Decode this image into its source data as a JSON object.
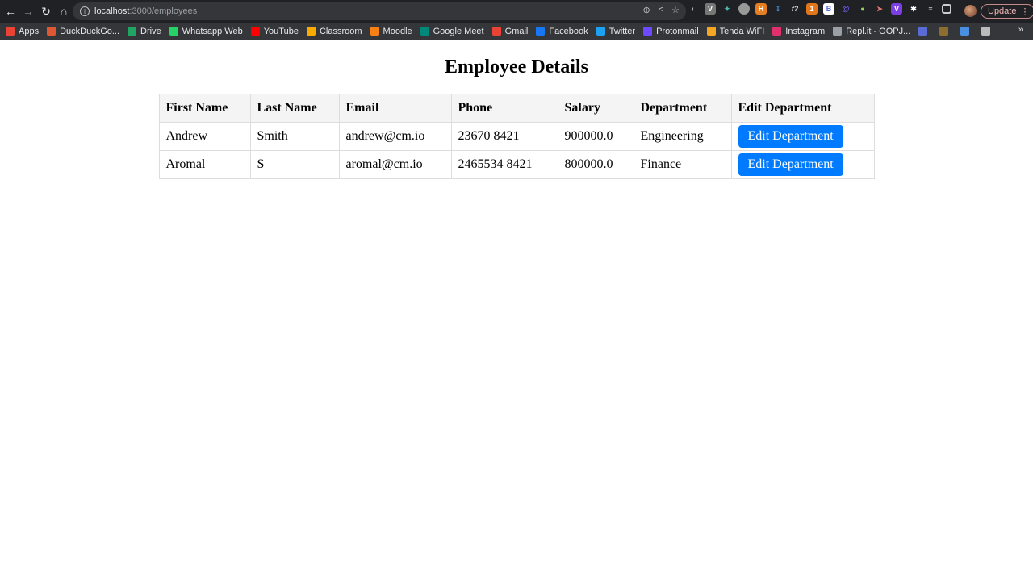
{
  "browser": {
    "url_host": "localhost",
    "url_path": ":3000/employees",
    "update_label": "Update",
    "bookmarks": [
      {
        "label": "Apps",
        "icon": "apps-grid-icon",
        "color": "#ea4335"
      },
      {
        "label": "DuckDuckGo...",
        "icon": "duckduckgo-icon",
        "color": "#de5833"
      },
      {
        "label": "Drive",
        "icon": "google-drive-icon",
        "color": "#1fa463"
      },
      {
        "label": "Whatsapp Web",
        "icon": "whatsapp-icon",
        "color": "#25d366"
      },
      {
        "label": "YouTube",
        "icon": "youtube-icon",
        "color": "#ff0000"
      },
      {
        "label": "Classroom",
        "icon": "classroom-icon",
        "color": "#f9ab00"
      },
      {
        "label": "Moodle",
        "icon": "moodle-icon",
        "color": "#f98012"
      },
      {
        "label": "Google Meet",
        "icon": "google-meet-icon",
        "color": "#00897b"
      },
      {
        "label": "Gmail",
        "icon": "gmail-icon",
        "color": "#ea4335"
      },
      {
        "label": "Facebook",
        "icon": "facebook-icon",
        "color": "#1877f2"
      },
      {
        "label": "Twitter",
        "icon": "twitter-icon",
        "color": "#1da1f2"
      },
      {
        "label": "Protonmail",
        "icon": "protonmail-icon",
        "color": "#6d4aff"
      },
      {
        "label": "Tenda WiFI",
        "icon": "tenda-icon",
        "color": "#f5a623"
      },
      {
        "label": "Instagram",
        "icon": "instagram-icon",
        "color": "#e1306c"
      },
      {
        "label": "Repl.it - OOPJ...",
        "icon": "replit-icon",
        "color": "#9aa0a6"
      }
    ],
    "more_label": "»"
  },
  "page": {
    "title": "Employee Details",
    "table": {
      "headers": [
        "First Name",
        "Last Name",
        "Email",
        "Phone",
        "Salary",
        "Department",
        "Edit Department"
      ],
      "rows": [
        {
          "first_name": "Andrew",
          "last_name": "Smith",
          "email": "andrew@cm.io",
          "phone": "23670 8421",
          "salary": "900000.0",
          "department": "Engineering",
          "action": "Edit Department"
        },
        {
          "first_name": "Aromal",
          "last_name": "S",
          "email": "aromal@cm.io",
          "phone": "2465534 8421",
          "salary": "800000.0",
          "department": "Finance",
          "action": "Edit Department"
        }
      ]
    },
    "accent_color": "#007bff"
  }
}
